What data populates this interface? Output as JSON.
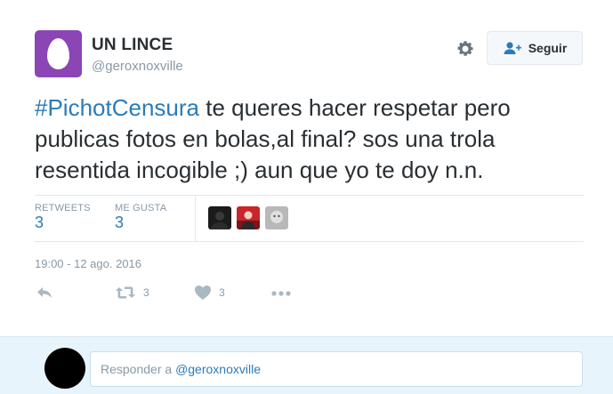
{
  "user": {
    "name": "UN LINCE",
    "handle": "@geroxnoxville",
    "avatar_color": "#8b45b5"
  },
  "header": {
    "follow_label": "Seguir",
    "settings_icon": "gear-icon",
    "follow_icon": "follow-user-icon"
  },
  "tweet": {
    "hashtag": "#PichotCensura",
    "text": " te queres hacer respetar pero publicas fotos en bolas,al final? sos una trola resentida incogible ;) aun que yo te doy n.n.",
    "timestamp": "19:00 - 12 ago. 2016"
  },
  "stats": {
    "retweets_label": "RETWEETS",
    "retweets_value": "3",
    "likes_label": "ME GUSTA",
    "likes_value": "3"
  },
  "likers": [
    "dark-avatar",
    "red-avatar",
    "gray-avatar"
  ],
  "actions": {
    "reply_icon": "reply-icon",
    "retweet_icon": "retweet-icon",
    "retweet_count": "3",
    "like_icon": "heart-icon",
    "like_count": "3",
    "more_icon": "more-icon"
  },
  "reply_box": {
    "prefix": "Responder a ",
    "mention": "@geroxnoxville"
  },
  "colors": {
    "accent": "#2b7bb9",
    "muted": "#8899a6",
    "reply_bg": "#e8f4fb"
  }
}
